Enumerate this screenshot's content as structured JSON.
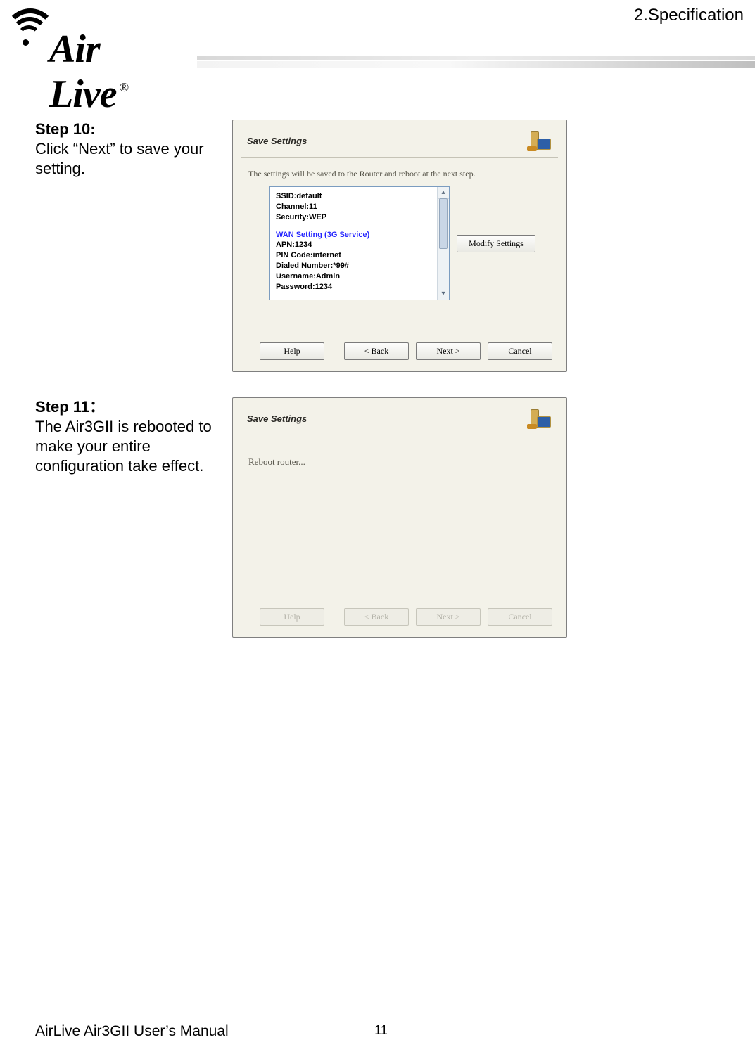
{
  "header": {
    "section": "2.Specification",
    "brand": "ir Live",
    "brand_prefix": "A",
    "reg": "®"
  },
  "step10": {
    "title": "Step 10:",
    "text": "Click “Next” to save your setting.",
    "pane_title": "Save Settings",
    "note": "The settings will be saved to the Router and reboot at the next step.",
    "listbox": {
      "ssid": "SSID:default",
      "channel": "Channel:11",
      "security": "Security:WEP",
      "wan_header": "WAN Setting  (3G Service)",
      "apn": "APN:1234",
      "pin": "PIN Code:internet",
      "dialed": "Dialed Number:*99#",
      "user": "Username:Admin",
      "pwd": "Password:1234"
    },
    "buttons": {
      "modify": "Modify Settings",
      "help": "Help",
      "back": "< Back",
      "next": "Next >",
      "cancel": "Cancel"
    }
  },
  "step11": {
    "title": "Step 11：",
    "text": "The Air3GII is rebooted to make your entire configuration take effect.",
    "pane_title": "Save Settings",
    "reboot": "Reboot router...",
    "buttons": {
      "help": "Help",
      "back": "< Back",
      "next": "Next >",
      "cancel": "Cancel"
    }
  },
  "footer": {
    "manual": "AirLive Air3GII User’s Manual",
    "page": "11"
  }
}
